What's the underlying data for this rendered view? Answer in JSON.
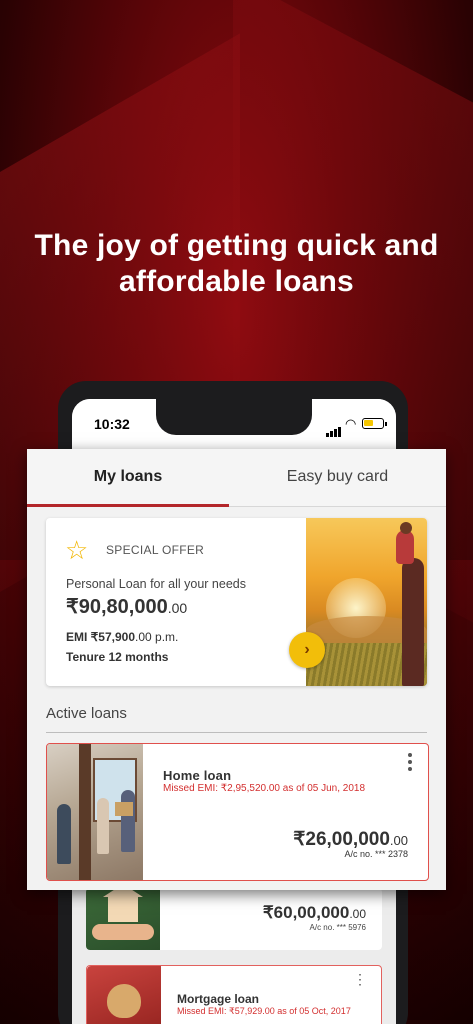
{
  "headline": {
    "line1": "The joy of getting quick and",
    "line2": "affordable loans"
  },
  "status_bar": {
    "time": "10:32"
  },
  "tabs": [
    {
      "label": "My loans",
      "active": true
    },
    {
      "label": "Easy buy card",
      "active": false
    }
  ],
  "offer": {
    "badge_icon": "star-icon",
    "badge_label": "SPECIAL OFFER",
    "description": "Personal Loan for all your needs",
    "amount_main": "₹90,80,000",
    "amount_decimal": ".00",
    "emi_main": "EMI ₹57,900",
    "emi_decimal": ".00 p.m.",
    "tenure": "Tenure 12 months",
    "action_icon": "chevron-right-icon"
  },
  "active_loans": {
    "title": "Active loans",
    "items": [
      {
        "title": "Home loan",
        "missed": "Missed EMI: ₹2,95,520.00 as of 05 Jun, 2018",
        "amount_main": "₹26,00,000",
        "amount_decimal": ".00",
        "account": "A/c no. *** 2378"
      },
      {
        "title": "",
        "missed": "",
        "amount_main": "₹60,00,000",
        "amount_decimal": ".00",
        "account": "A/c no. *** 5976"
      },
      {
        "title": "Mortgage loan",
        "missed": "Missed EMI: ₹57,929.00 as of 05 Oct, 2017",
        "amount_main": "",
        "amount_decimal": "",
        "account": ""
      }
    ]
  },
  "colors": {
    "brand_red": "#b3262a",
    "accent_yellow": "#f2be0a",
    "alert_red": "#d32f2f"
  }
}
